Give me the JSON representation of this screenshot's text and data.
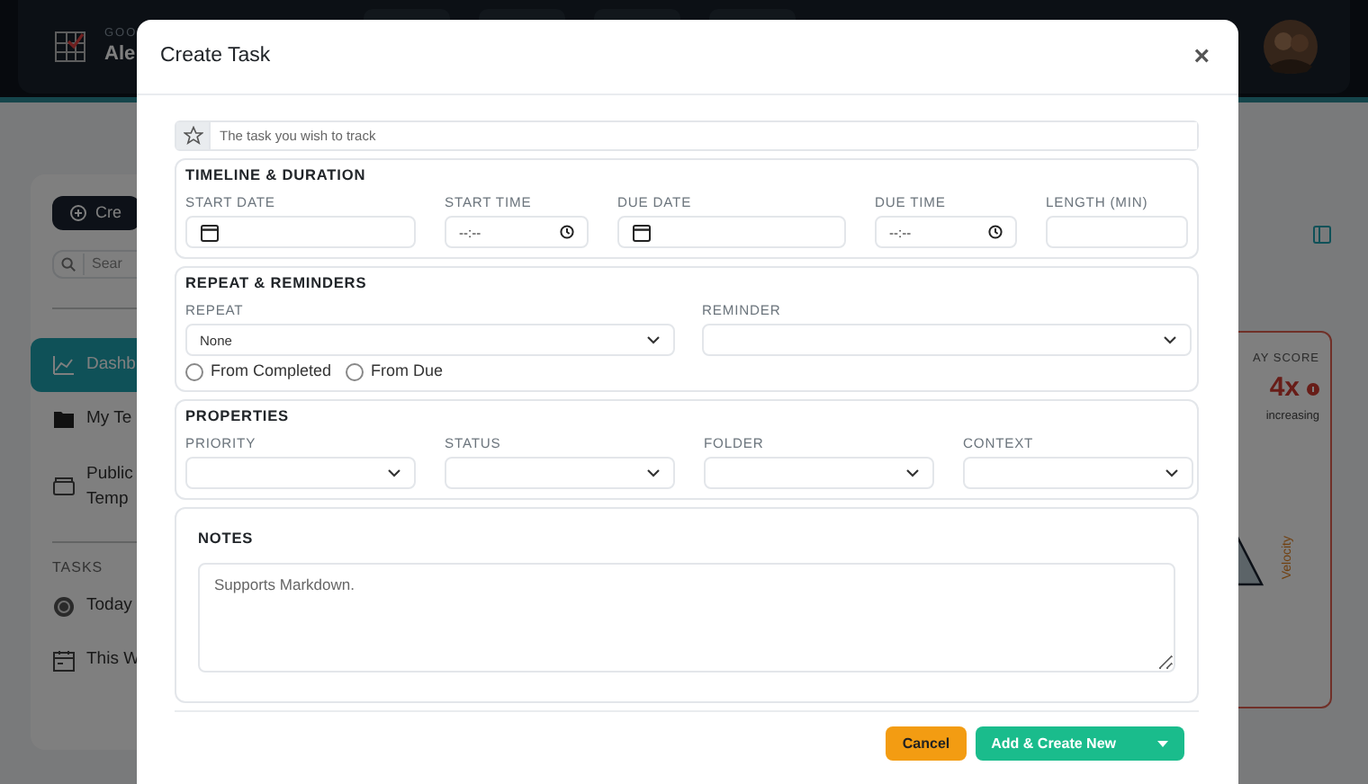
{
  "background": {
    "greeting": "GOO",
    "name": "Ale",
    "sidebar": {
      "create_button": "Cre",
      "search_placeholder": "Sear",
      "items": [
        {
          "label": "Dashb",
          "selected": true
        },
        {
          "label": "My Te",
          "selected": false
        },
        {
          "label": "Public Temp",
          "selected": false
        }
      ],
      "section_title": "TASKS",
      "task_items": [
        {
          "label": "Today",
          "selected": false
        },
        {
          "label": "This W",
          "selected": false
        }
      ]
    },
    "score_card": {
      "title": "AY SCORE",
      "value": "4x",
      "trend": "increasing",
      "chart_label": "Velocity"
    }
  },
  "modal": {
    "title": "Create Task",
    "close": "×",
    "task_field": {
      "placeholder": "The task you wish to track"
    },
    "timeline": {
      "title": "TIMELINE & DURATION",
      "fields": [
        {
          "label": "START DATE",
          "kind": "date"
        },
        {
          "label": "START TIME",
          "kind": "time",
          "placeholder": "--:--"
        },
        {
          "label": "DUE DATE",
          "kind": "date"
        },
        {
          "label": "DUE TIME",
          "kind": "time",
          "placeholder": "--:--"
        },
        {
          "label": "LENGTH (MIN)",
          "kind": "number"
        }
      ]
    },
    "repeat": {
      "title": "REPEAT & REMINDERS",
      "selects": [
        {
          "label": "REPEAT",
          "value": "None"
        },
        {
          "label": "REMINDER"
        }
      ],
      "radios": [
        {
          "label": "From Completed",
          "selected": false
        },
        {
          "label": "From Due",
          "selected": false
        }
      ]
    },
    "properties": {
      "title": "PROPERTIES",
      "selects": [
        {
          "label": "PRIORITY"
        },
        {
          "label": "STATUS"
        },
        {
          "label": "FOLDER"
        },
        {
          "label": "CONTEXT"
        }
      ]
    },
    "notes": {
      "title": "NOTES",
      "placeholder": "Supports Markdown."
    },
    "buttons": {
      "cancel": "Cancel",
      "submit": "Add & Create New"
    }
  }
}
